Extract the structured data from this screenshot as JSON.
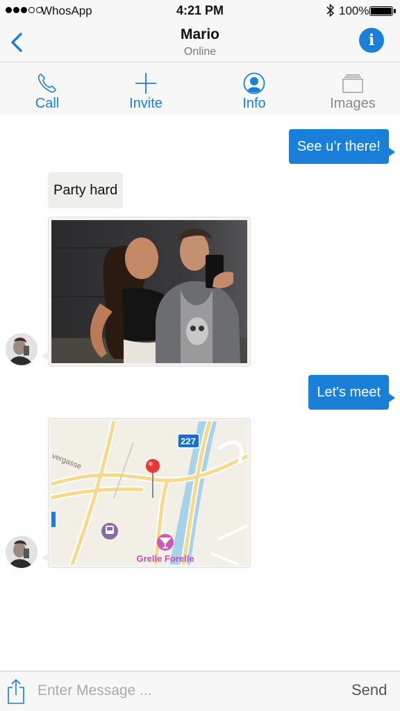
{
  "status_bar": {
    "carrier": "WhosApp",
    "time": "4:21 PM",
    "battery": "100%",
    "signal_bars_filled": 3,
    "signal_bars_total": 5
  },
  "nav": {
    "contact_name": "Mario",
    "contact_status": "Online",
    "info_icon": "i"
  },
  "toolbar": {
    "call": "Call",
    "invite": "Invite",
    "info": "Info",
    "images": "Images"
  },
  "messages": {
    "sent_1": "See u’r there!",
    "received_1": "Party hard",
    "sent_2": "Let's meet"
  },
  "map": {
    "street_label": "vergasse",
    "route_shield": "227",
    "poi_name": "Grelle Forelle"
  },
  "composer": {
    "placeholder": "Enter Message ...",
    "send_label": "Send"
  },
  "colors": {
    "accent": "#1a7fd8",
    "incoming_bubble": "#eeeeec",
    "bar_background": "#f7f7f7"
  }
}
